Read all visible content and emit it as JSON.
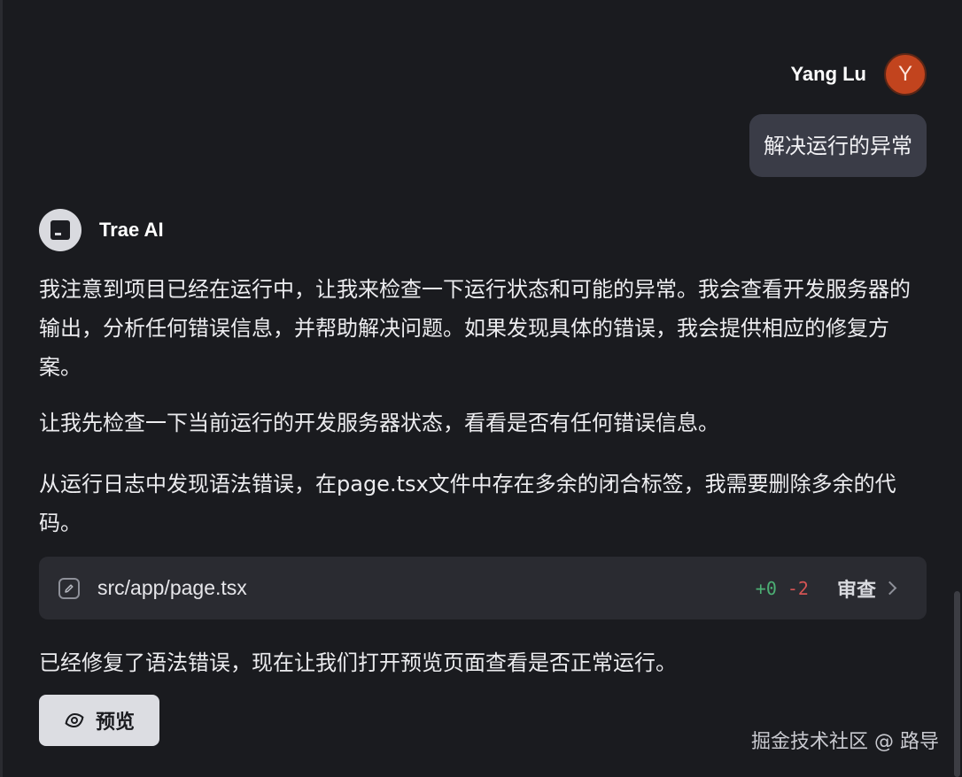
{
  "user": {
    "name": "Yang Lu",
    "avatar_initial": "Y",
    "message": "解决运行的异常"
  },
  "ai": {
    "name": "Trae AI",
    "paragraphs": [
      "我注意到项目已经在运行中，让我来检查一下运行状态和可能的异常。我会查看开发服务器的输出，分析任何错误信息，并帮助解决问题。如果发现具体的错误，我会提供相应的修复方案。",
      "让我先检查一下当前运行的开发服务器状态，看看是否有任何错误信息。",
      "从运行日志中发现语法错误，在page.tsx文件中存在多余的闭合标签，我需要删除多余的代码。",
      "已经修复了语法错误，现在让我们打开预览页面查看是否正常运行。"
    ],
    "file_change": {
      "icon": "pencil-edit-icon",
      "path": "src/app/page.tsx",
      "additions": "+0",
      "deletions": "-2",
      "review_label": "审查"
    },
    "preview_button_label": "预览"
  },
  "watermark": "掘金技术社区 @ 路导",
  "colors": {
    "background": "#1a1b1f",
    "user_avatar": "#c2441e",
    "user_bubble": "#3a3c47",
    "file_card": "#2a2b31",
    "diff_add": "#4caf74",
    "diff_del": "#d45454",
    "preview_button": "#dcdde2"
  }
}
